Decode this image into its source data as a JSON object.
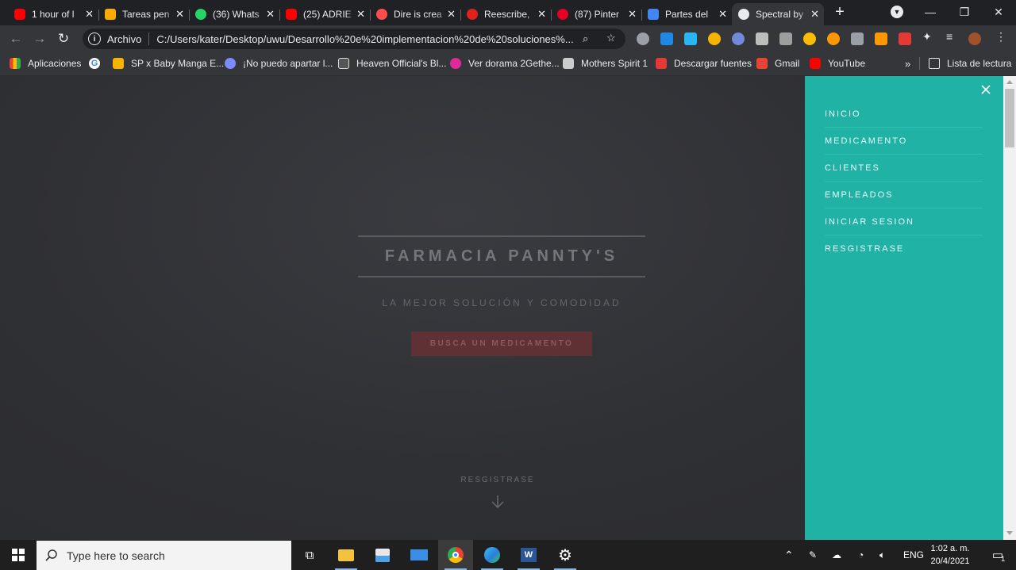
{
  "tabs": [
    {
      "title": "1 hour of l",
      "icon": "youtube-icon",
      "color": "#ff0000"
    },
    {
      "title": "Tareas pen",
      "icon": "classroom-icon",
      "color": "#f9ab00"
    },
    {
      "title": "(36) Whats",
      "icon": "whatsapp-icon",
      "color": "#25d366"
    },
    {
      "title": "(25) ADRIE",
      "icon": "youtube-icon",
      "color": "#ff0000"
    },
    {
      "title": "Dire is crea",
      "icon": "webtoon-icon",
      "color": "#ff4d4d"
    },
    {
      "title": "Reescribe,",
      "icon": "rewriter-icon",
      "color": "#e0211c"
    },
    {
      "title": "(87) Pinter",
      "icon": "pinterest-icon",
      "color": "#e60023"
    },
    {
      "title": "Partes del",
      "icon": "page-icon",
      "color": "#4285f4"
    },
    {
      "title": "Spectral by",
      "icon": "globe-icon",
      "color": "#e8eaed",
      "active": true
    }
  ],
  "address": {
    "info_label": "i",
    "scheme": "Archivo",
    "url": "C:/Users/kater/Desktop/uwu/Desarrollo%20e%20implementacion%20de%20soluciones%..."
  },
  "bookmarks": [
    {
      "label": "Aplicaciones",
      "icon": "apps-grid-icon",
      "color": "#4285f4"
    },
    {
      "label": "",
      "icon": "google-icon",
      "color": "#ffffff"
    },
    {
      "label": "SP x Baby Manga E...",
      "icon": "manga-icon",
      "color": "#f4b400"
    },
    {
      "label": "¡No puedo apartar l...",
      "icon": "manga2-icon",
      "color": "#7b8cff"
    },
    {
      "label": "Heaven Official's Bl...",
      "icon": "book-icon",
      "color": "#dddddd"
    },
    {
      "label": "Ver dorama 2Gethe...",
      "icon": "dorama-icon",
      "color": "#e02a9b"
    },
    {
      "label": "Mothers Spirit 1",
      "icon": "page-icon",
      "color": "#cccccc"
    },
    {
      "label": "Descargar fuentes",
      "icon": "font-icon",
      "color": "#e53935"
    },
    {
      "label": "Gmail",
      "icon": "gmail-icon",
      "color": "#ea4335"
    },
    {
      "label": "YouTube",
      "icon": "youtube-icon",
      "color": "#ff0000"
    }
  ],
  "reading_list": "Lista de lectura",
  "page": {
    "title": "FARMACIA PANNTY'S",
    "subtitle": "LA MEJOR SOLUCIÓN Y COMODIDAD",
    "cta": "BUSCA UN MEDICAMENTO",
    "more": "RESGISTRASE"
  },
  "menu": {
    "items": [
      "INICIO",
      "MEDICAMENTO",
      "CLIENTES",
      "EMPLEADOS",
      "INICIAR SESION",
      "RESGISTRASE"
    ]
  },
  "taskbar": {
    "search_placeholder": "Type here to search",
    "lang": "ENG",
    "time": "1:02 a. m.",
    "date": "20/4/2021",
    "notification_count": "1"
  },
  "colors": {
    "menu_bg": "#21b2a6",
    "cta_bg": "#5e3234",
    "page_bg": "#2f3034",
    "browser_chrome": "#35363a"
  }
}
